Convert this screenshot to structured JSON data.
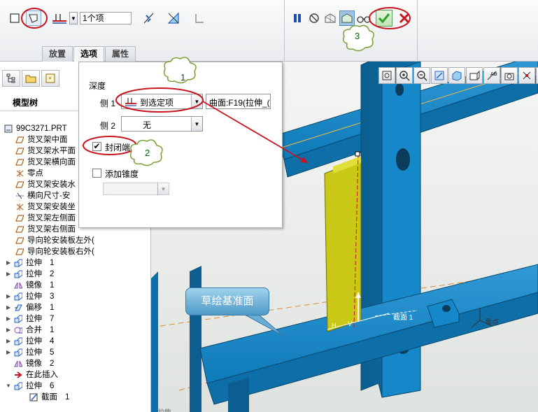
{
  "toolbar": {
    "count_value": "1个项"
  },
  "tabs": [
    {
      "label": "放置"
    },
    {
      "label": "选项"
    },
    {
      "label": "属性"
    }
  ],
  "left_panel": {
    "tree_title": "模型树"
  },
  "tree": [
    {
      "text": "99C3271.PRT",
      "icon": "part-icon"
    },
    {
      "text": "货叉架中面",
      "icon": "datum-plane-icon"
    },
    {
      "text": "货叉架水平面",
      "icon": "datum-plane-icon"
    },
    {
      "text": "货叉架横向面",
      "icon": "datum-plane-icon"
    },
    {
      "text": "零点",
      "icon": "coordinate-system-icon"
    },
    {
      "text": "货叉架安装水",
      "icon": "datum-plane-icon"
    },
    {
      "text": "横向尺寸-安",
      "icon": "datum-axis-icon"
    },
    {
      "text": "货叉架安装坐",
      "icon": "coordinate-system-icon"
    },
    {
      "text": "货叉架左侧面",
      "icon": "datum-plane-icon"
    },
    {
      "text": "货叉架右侧面",
      "icon": "datum-plane-icon"
    },
    {
      "text": "导向轮安装板左外(",
      "icon": "datum-plane-icon"
    },
    {
      "text": "导向轮安装板右外(",
      "icon": "datum-plane-icon"
    },
    {
      "text": "拉伸",
      "num": "1",
      "icon": "extrude-icon"
    },
    {
      "text": "拉伸",
      "num": "2",
      "icon": "extrude-icon"
    },
    {
      "text": "镜像",
      "num": "1",
      "icon": "mirror-icon"
    },
    {
      "text": "拉伸",
      "num": "3",
      "icon": "extrude-icon"
    },
    {
      "text": "偏移",
      "num": "1",
      "icon": "offset-icon"
    },
    {
      "text": "拉伸",
      "num": "7",
      "icon": "extrude-icon"
    },
    {
      "text": "合并",
      "num": "1",
      "icon": "merge-icon"
    },
    {
      "text": "拉伸",
      "num": "4",
      "icon": "extrude-icon"
    },
    {
      "text": "拉伸",
      "num": "5",
      "icon": "extrude-icon"
    },
    {
      "text": "镜像",
      "num": "2",
      "icon": "mirror-icon"
    },
    {
      "text": "在此插入",
      "icon": "insert-here-arrow-icon"
    },
    {
      "text": "拉伸",
      "num": "6",
      "icon": "extrude-icon"
    },
    {
      "text": "截面",
      "num": "1",
      "icon": "sketch-section-icon"
    }
  ],
  "options_panel": {
    "depth_label": "深度",
    "side1_label": "侧 1",
    "side1_value": "到选定项",
    "side1_reference": "曲面:F19(拉伸_(",
    "side2_label": "侧 2",
    "side2_value": "无",
    "capped_ends_label": "封闭端",
    "capped_ends_checked": true,
    "add_taper_label": "添加锥度",
    "add_taper_checked": false
  },
  "annotations": {
    "num1": "1",
    "num2": "2",
    "num3": "3",
    "sketch_callout": "草绘基准面"
  },
  "viewport": {
    "section_label": "截面 1",
    "csys_label": "零点",
    "dim_h": "H",
    "dim_v": "V",
    "bottom_text": "拉伸"
  },
  "colors": {
    "frame_blue": "#0f7ab8",
    "frame_dark": "#0b5e8f",
    "extrude_yellow": "#c9c816",
    "annotation_red": "#c8141e",
    "callout_blue": "#5aa3d0",
    "accept_green": "#2aa12a"
  }
}
